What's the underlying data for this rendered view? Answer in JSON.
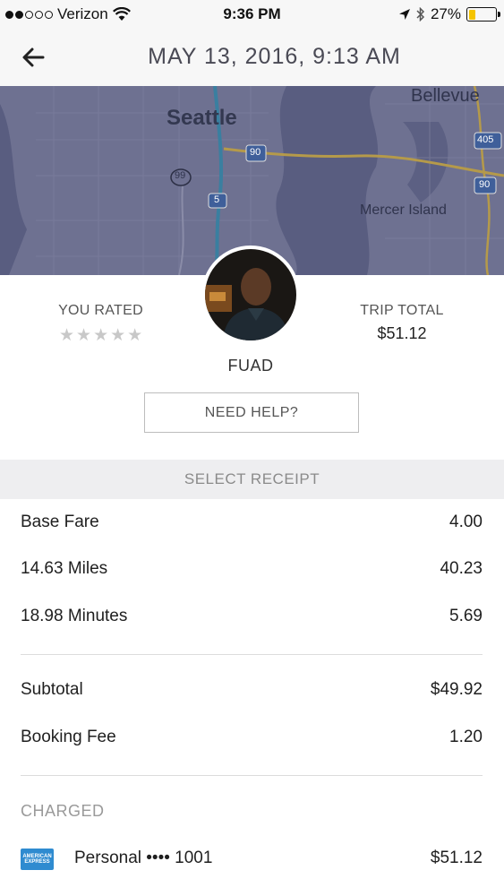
{
  "status_bar": {
    "carrier": "Verizon",
    "time": "9:36 PM",
    "battery_pct": "27%",
    "battery_level": 0.27,
    "signal_bars_filled": 2,
    "signal_bars_total": 5
  },
  "header": {
    "title": "MAY 13, 2016, 9:13 AM"
  },
  "map": {
    "labels": {
      "seattle": "Seattle",
      "bellevue": "Bellevue",
      "mercer_island": "Mercer Island",
      "hwy_405": "405",
      "hwy_90_a": "90",
      "hwy_90_b": "90",
      "hwy_99": "99",
      "hwy_5": "5"
    }
  },
  "trip": {
    "you_rated_label": "YOU RATED",
    "rating_stars": "★★★★★",
    "rating_value": 0,
    "trip_total_label": "TRIP TOTAL",
    "trip_total_value": "$51.12",
    "driver_name": "FUAD",
    "need_help_label": "NEED HELP?"
  },
  "receipt": {
    "select_label": "SELECT RECEIPT",
    "items": [
      {
        "label": "Base Fare",
        "amount": "4.00"
      },
      {
        "label": "14.63 Miles",
        "amount": "40.23"
      },
      {
        "label": "18.98 Minutes",
        "amount": "5.69"
      }
    ],
    "subtotal": {
      "label": "Subtotal",
      "amount": "$49.92"
    },
    "booking_fee": {
      "label": "Booking Fee",
      "amount": "1.20"
    },
    "charged_label": "CHARGED",
    "payment": {
      "card_brand": "AMERICAN EXPRESS",
      "label": "Personal •••• 1001",
      "amount": "$51.12"
    }
  },
  "colors": {
    "map_overlay": "#6e7191",
    "card_blue": "#2f8bd0",
    "battery_yellow": "#f5c400"
  }
}
